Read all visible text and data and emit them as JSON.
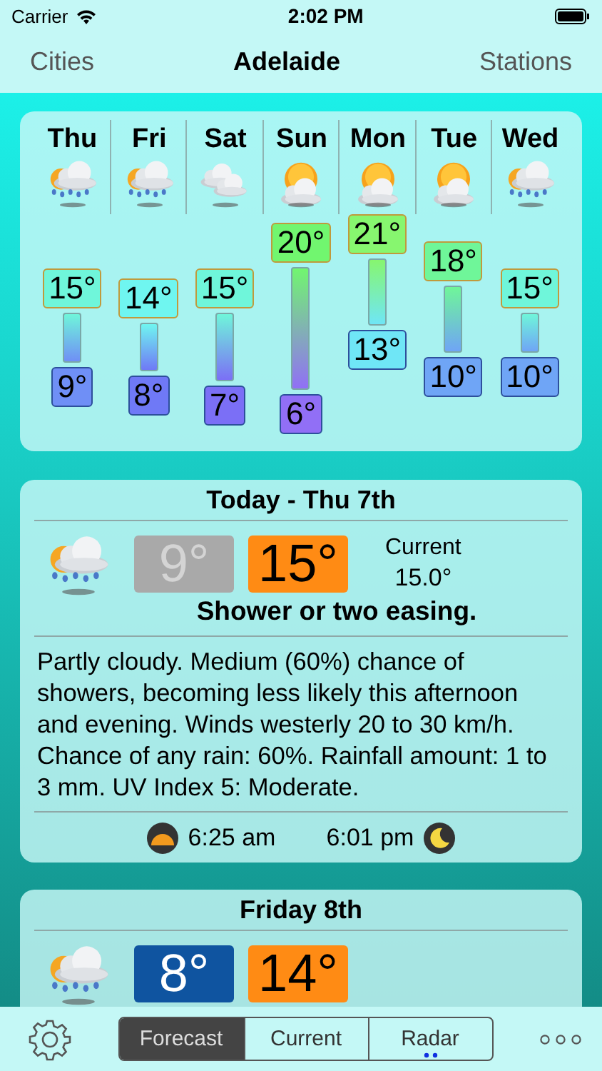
{
  "status_bar": {
    "carrier": "Carrier",
    "time": "2:02 PM"
  },
  "nav": {
    "left": "Cities",
    "title": "Adelaide",
    "right": "Stations"
  },
  "week": [
    {
      "day": "Thu",
      "kind": "shower",
      "high": "15°",
      "low": "9°"
    },
    {
      "day": "Fri",
      "kind": "shower",
      "high": "14°",
      "low": "8°"
    },
    {
      "day": "Sat",
      "kind": "cloudy",
      "high": "15°",
      "low": "7°"
    },
    {
      "day": "Sun",
      "kind": "sun-cloud",
      "high": "20°",
      "low": "6°"
    },
    {
      "day": "Mon",
      "kind": "sun-cloud",
      "high": "21°",
      "low": "13°"
    },
    {
      "day": "Tue",
      "kind": "sun-cloud",
      "high": "18°",
      "low": "10°"
    },
    {
      "day": "Wed",
      "kind": "shower",
      "high": "15°",
      "low": "10°"
    }
  ],
  "today": {
    "title": "Today - Thu 7th",
    "kind": "shower",
    "low": "9°",
    "low_past": true,
    "high": "15°",
    "current_label": "Current",
    "current_value": "15.0°",
    "summary": "Shower or two easing.",
    "description": "Partly cloudy. Medium (60%) chance of showers, becoming less likely this afternoon and evening. Winds westerly 20 to 30 km/h. Chance of any rain: 60%. Rainfall amount: 1 to 3 mm. UV Index 5: Moderate.",
    "sunrise": "6:25 am",
    "sunset": "6:01 pm"
  },
  "next_day": {
    "title": "Friday 8th",
    "kind": "shower",
    "low": "8°",
    "low_past": false,
    "high": "14°"
  },
  "tabs": [
    {
      "label": "Forecast",
      "selected": true,
      "has_pages": false
    },
    {
      "label": "Current",
      "selected": false,
      "has_pages": false
    },
    {
      "label": "Radar",
      "selected": false,
      "has_pages": true
    }
  ]
}
